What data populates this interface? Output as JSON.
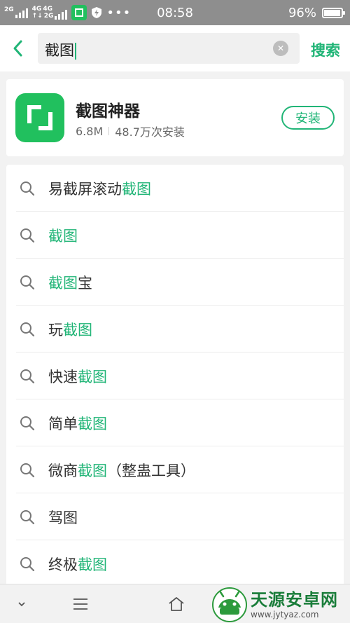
{
  "status_bar": {
    "network_1": "2G",
    "network_2": "4G",
    "network_3": "4G",
    "network_4": "2G",
    "time": "08:58",
    "battery_percent": "96%",
    "battery_level": 0.96,
    "more": "•••"
  },
  "search": {
    "query": "截图",
    "clear_symbol": "✕",
    "search_label": "搜索"
  },
  "app_result": {
    "name": "截图神器",
    "size": "6.8M",
    "installs": "48.7万次安装",
    "install_label": "安装",
    "icon_color": "#21c05e"
  },
  "suggestions": [
    {
      "pre": "易截屏滚动",
      "hl": "截图",
      "post": ""
    },
    {
      "pre": "",
      "hl": "截图",
      "post": ""
    },
    {
      "pre": "",
      "hl": "截图",
      "post": "宝"
    },
    {
      "pre": "玩",
      "hl": "截图",
      "post": ""
    },
    {
      "pre": "快速",
      "hl": "截图",
      "post": ""
    },
    {
      "pre": "简单",
      "hl": "截图",
      "post": ""
    },
    {
      "pre": "微商",
      "hl": "截图",
      "post": "（整蛊工具）"
    },
    {
      "pre": "驾图",
      "hl": "",
      "post": ""
    },
    {
      "pre": "终极",
      "hl": "截图",
      "post": ""
    }
  ],
  "nav_icons": [
    "chevron-down-icon",
    "menu-icon",
    "home-icon"
  ],
  "watermark": {
    "title": "天源安卓网",
    "url": "www.jytyaz.com"
  },
  "colors": {
    "accent": "#21b577",
    "status_bar_bg": "#8e8e8e"
  }
}
